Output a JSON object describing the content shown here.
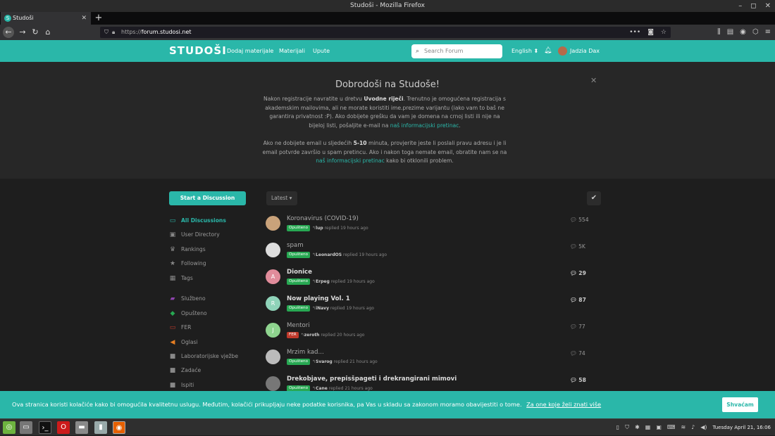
{
  "window": {
    "title": "Studoši - Mozilla Firefox"
  },
  "browser": {
    "tab_title": "Studoši",
    "url_prefix": "https://",
    "url_host": "forum.studosi.net"
  },
  "header": {
    "logo": "STUDOŠI",
    "nav": [
      "Dodaj materijale",
      "Materijali",
      "Upute"
    ],
    "search_placeholder": "Search Forum",
    "language": "English",
    "username": "Jadzia Dax"
  },
  "hero": {
    "title": "Dobrodoši na Studoše!",
    "p1_a": "Nakon registracije navratite u dretvu ",
    "p1_b": "Uvodne riječi",
    "p1_c": ". Trenutno je omogućena registracija s akademskim mailovima, ali ne morate koristiti ime.prezime varijantu (iako vam to baš ne garantira privatnost :P). Ako dobijete grešku da vam je domena na crnoj listi ili nije na bijeloj listi, pošaljite e-mail na ",
    "p1_link": "naš informacijski pretinac",
    "p1_d": ".",
    "p2_a": "Ako ne dobijete email u sljedećih ",
    "p2_b": "5-10",
    "p2_c": " minuta, provjerite jeste li poslali pravu adresu i je li email potvrde završio u spam pretincu. Ako i nakon toga nemate email, obratite nam se na ",
    "p2_link": "naš informacijski pretinac",
    "p2_d": " kako bi otklonili problem."
  },
  "toolbar": {
    "start_label": "Start a Discussion",
    "sort_label": "Latest"
  },
  "sidebar": {
    "items": [
      {
        "label": "All Discussions",
        "icon": "comments-icon",
        "color": "#2ab7a9"
      },
      {
        "label": "User Directory",
        "icon": "address-book-icon",
        "color": "#888888"
      },
      {
        "label": "Rankings",
        "icon": "trophy-icon",
        "color": "#888888"
      },
      {
        "label": "Following",
        "icon": "star-icon",
        "color": "#888888"
      },
      {
        "label": "Tags",
        "icon": "tags-icon",
        "color": "#888888"
      },
      {
        "label": "Službeno",
        "icon": "scroll-icon",
        "color": "#8e44ad"
      },
      {
        "label": "Opušteno",
        "icon": "gamepad-icon",
        "color": "#27a852"
      },
      {
        "label": "FER",
        "icon": "monitor-icon",
        "color": "#c0392b"
      },
      {
        "label": "Oglasi",
        "icon": "megaphone-icon",
        "color": "#e67e22"
      },
      {
        "label": "Laboratorijske vježbe",
        "icon": "tag-icon",
        "color": "#888888"
      },
      {
        "label": "Zadaće",
        "icon": "tag-icon",
        "color": "#888888"
      },
      {
        "label": "Ispiti",
        "icon": "tag-icon",
        "color": "#888888"
      }
    ]
  },
  "discussions": [
    {
      "title": "Koronavirus (COVID-19)",
      "unread": false,
      "tag": "Opušteno",
      "tag_color": "#27a852",
      "user": "lup",
      "time": "replied 19 hours ago",
      "count": "554",
      "avatar": "",
      "avatar_color": "#c9a27a"
    },
    {
      "title": "spam",
      "unread": false,
      "tag": "Opušteno",
      "tag_color": "#27a852",
      "user": "LeonardOS",
      "time": "replied 19 hours ago",
      "count": "5K",
      "avatar": "",
      "avatar_color": "#dddddd"
    },
    {
      "title": "Dionice",
      "unread": true,
      "tag": "Opušteno",
      "tag_color": "#27a852",
      "user": "Erpeg",
      "time": "replied 19 hours ago",
      "count": "29",
      "avatar": "A",
      "avatar_color": "#e18c9b"
    },
    {
      "title": "Now playing Vol. 1",
      "unread": true,
      "tag": "Opušteno",
      "tag_color": "#27a852",
      "user": "iNavy",
      "time": "replied 19 hours ago",
      "count": "87",
      "avatar": "R",
      "avatar_color": "#8fd3b9"
    },
    {
      "title": "Mentori",
      "unread": false,
      "tag": "FER",
      "tag_color": "#c0392b",
      "user": "zeroth",
      "time": "replied 20 hours ago",
      "count": "77",
      "avatar": "J",
      "avatar_color": "#8fd48f"
    },
    {
      "title": "Mrzim kad...",
      "unread": false,
      "tag": "Opušteno",
      "tag_color": "#27a852",
      "user": "Svarog",
      "time": "replied 21 hours ago",
      "count": "74",
      "avatar": "",
      "avatar_color": "#bbbbbb"
    },
    {
      "title": "Drekobjave, prepisšpageti i drekrangirani mimovi",
      "unread": true,
      "tag": "Opušteno",
      "tag_color": "#27a852",
      "user": "Cane",
      "time": "replied 21 hours ago",
      "count": "58",
      "avatar": "",
      "avatar_color": "#777777"
    }
  ],
  "cookie": {
    "text": "Ova stranica koristi kolačiće kako bi omogućila kvalitetnu uslugu. Međutim, kolačići prikupljaju neke podatke korisnika, pa Vas u skladu sa zakonom moramo obavijestiti o tome.",
    "link": "Za one koje želi znati više",
    "button": "Shvaćam"
  },
  "taskbar": {
    "clock": "Tuesday April 21, 16:06"
  },
  "colors": {
    "accent": "#2ab7a9",
    "bg": "#1e1e1e"
  }
}
